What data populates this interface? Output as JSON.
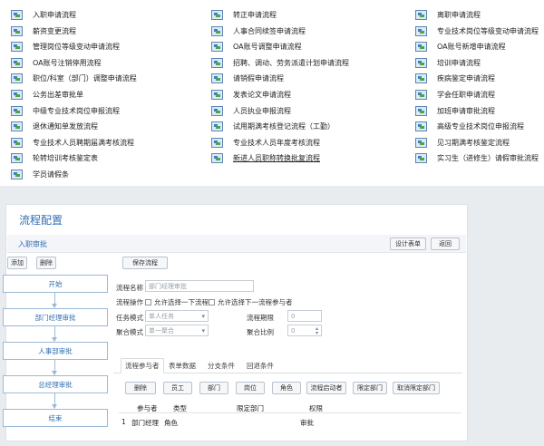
{
  "flow_links": [
    {
      "label": "入职申请流程"
    },
    {
      "label": "转正申请流程"
    },
    {
      "label": "离职申请流程"
    },
    {
      "label": "薪资变更流程"
    },
    {
      "label": "人事合同续签申请流程"
    },
    {
      "label": "专业技术岗位等级变动申请流程"
    },
    {
      "label": "管理岗位等级变动申请流程"
    },
    {
      "label": "OA账号调整申请流程"
    },
    {
      "label": "OA账号新增申请流程"
    },
    {
      "label": "OA账号注销停用流程"
    },
    {
      "label": "招聘、调动、劳务派遣计划申请流程"
    },
    {
      "label": "培训申请流程"
    },
    {
      "label": "职位/科室（部门）调整申请流程"
    },
    {
      "label": "请销假申请流程"
    },
    {
      "label": "疾病鉴定申请流程"
    },
    {
      "label": "公务出差审批单"
    },
    {
      "label": "发表论文申请流程"
    },
    {
      "label": "学会任职申请流程"
    },
    {
      "label": "中级专业技术岗位申报流程"
    },
    {
      "label": "人员执业申报流程"
    },
    {
      "label": "加班申请审批流程"
    },
    {
      "label": "退休通知单发放流程"
    },
    {
      "label": "试用期满考核登记流程（工勤）"
    },
    {
      "label": "高级专业技术岗位申报流程"
    },
    {
      "label": "专业技术人员聘期届满考核流程"
    },
    {
      "label": "专业技术人员年度考核流程"
    },
    {
      "label": "见习期满考核鉴定流程"
    },
    {
      "label": "轮转培训考核鉴定表"
    },
    {
      "label": "新进人员职称转换批复流程"
    },
    {
      "label": "实习生（进修生）请假审批流程"
    },
    {
      "label": "学员请假条"
    }
  ],
  "config": {
    "title": "流程配置",
    "subtitle": "入职审批",
    "design_form": "设计表单",
    "back": "返回",
    "add": "添加",
    "delete": "删除",
    "save_flow": "保存流程"
  },
  "steps": [
    "开始",
    "部门经理审批",
    "人事部审批",
    "总经理审批",
    "结束"
  ],
  "form": {
    "flow_name_label": "流程名称",
    "flow_name_value": "部门经理审批",
    "flow_op_label": "流程操作",
    "opt1": "允许选择一下流程",
    "opt2": "允许选择下一流程参与者",
    "task_mode_label": "任务模式",
    "task_mode_value": "单人任务",
    "flow_limit_label": "流程期限",
    "flow_limit_value": "0",
    "agg_mode_label": "聚合模式",
    "agg_mode_value": "单一聚合",
    "agg_ratio_label": "聚合比例",
    "agg_ratio_value": "0"
  },
  "tabs": [
    "流程参与者",
    "表单数据",
    "分支条件",
    "回退条件"
  ],
  "actions": [
    "删除",
    "员工",
    "部门",
    "岗位",
    "角色",
    "流程启动者",
    "限定部门",
    "取消限定部门"
  ],
  "grid": {
    "headers": [
      "参与者",
      "类型",
      "限定部门",
      "权限"
    ],
    "rows": [
      {
        "no": "1",
        "participant": "部门经理",
        "type": "角色",
        "dept": "",
        "perm": "审批"
      }
    ]
  }
}
